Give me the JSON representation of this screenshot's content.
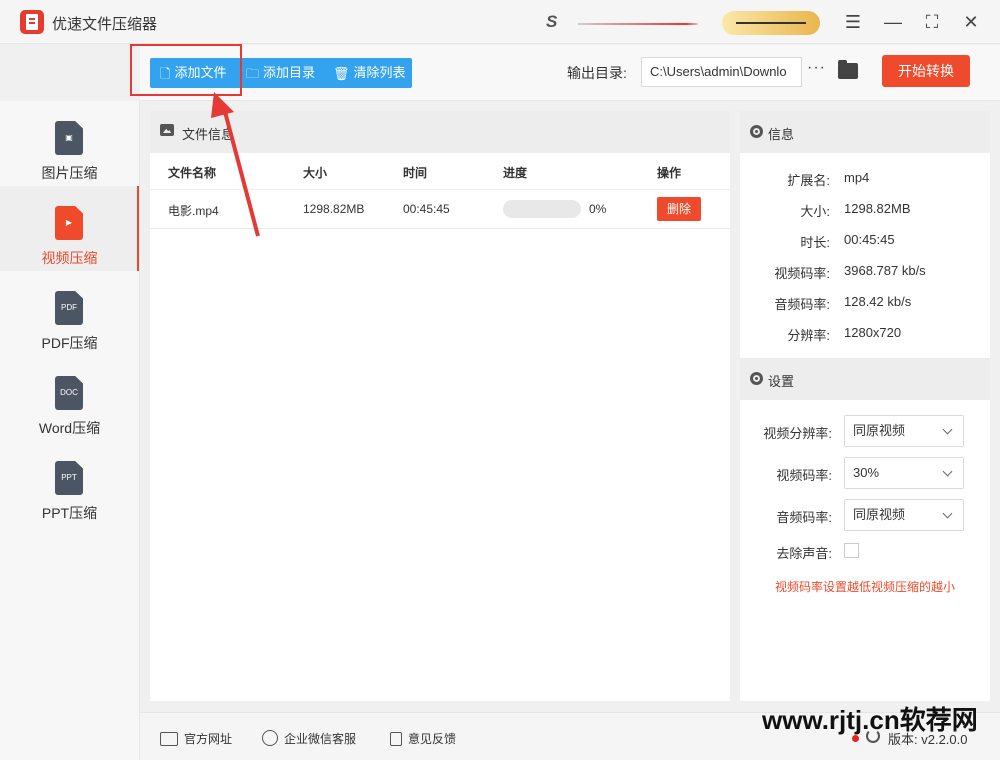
{
  "app": {
    "title": "优速文件压缩器"
  },
  "toolbar": {
    "add_file": "添加文件",
    "add_dir": "添加目录",
    "clear_list": "清除列表",
    "output_label": "输出目录:",
    "output_path": "C:\\Users\\admin\\Downlo",
    "more": "···",
    "start": "开始转换"
  },
  "sidebar": {
    "items": [
      {
        "label": "图片压缩",
        "icon": "image-file-icon"
      },
      {
        "label": "视频压缩",
        "icon": "video-file-icon",
        "active": true
      },
      {
        "label": "PDF压缩",
        "icon": "pdf-file-icon",
        "badge": "PDF"
      },
      {
        "label": "Word压缩",
        "icon": "doc-file-icon",
        "badge": "DOC"
      },
      {
        "label": "PPT压缩",
        "icon": "ppt-file-icon",
        "badge": "PPT"
      }
    ]
  },
  "file_panel": {
    "title": "文件信息",
    "columns": [
      "文件名称",
      "大小",
      "时间",
      "进度",
      "操作"
    ],
    "rows": [
      {
        "name": "电影.mp4",
        "size": "1298.82MB",
        "time": "00:45:45",
        "progress": 0,
        "progress_label": "0%",
        "action": "删除"
      }
    ]
  },
  "info": {
    "title": "信息",
    "fields": [
      {
        "k": "扩展名:",
        "v": "mp4"
      },
      {
        "k": "大小:",
        "v": "1298.82MB"
      },
      {
        "k": "时长:",
        "v": "00:45:45"
      },
      {
        "k": "视频码率:",
        "v": "3968.787 kb/s"
      },
      {
        "k": "音频码率:",
        "v": "128.42 kb/s"
      },
      {
        "k": "分辨率:",
        "v": "1280x720"
      }
    ]
  },
  "settings": {
    "title": "设置",
    "video_res_label": "视频分辨率:",
    "video_res_value": "同原视频",
    "video_bitrate_label": "视频码率:",
    "video_bitrate_value": "30%",
    "audio_bitrate_label": "音频码率:",
    "audio_bitrate_value": "同原视频",
    "mute_label": "去除声音:",
    "hint": "视频码率设置越低视频压缩的越小"
  },
  "footer": {
    "website": "官方网址",
    "wechat": "企业微信客服",
    "feedback": "意见反馈",
    "version": "版本: v2.2.0.0"
  },
  "watermark": "www.rjtj.cn软荐网",
  "colors": {
    "accent_blue": "#34a3ef",
    "accent_red": "#ee4a2b",
    "annotation_red": "#e53935"
  }
}
